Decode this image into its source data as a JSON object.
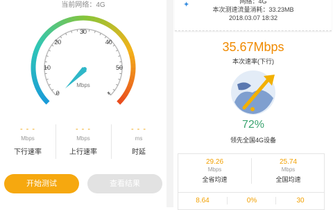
{
  "left": {
    "network_label": "当前网络：4G",
    "gauge": {
      "ticks": [
        "0",
        "10",
        "20",
        "30",
        "40",
        "50",
        "+"
      ],
      "unit": "Mbps",
      "needle_value": 0
    },
    "metrics": [
      {
        "value": "- - -",
        "unit": "Mbps",
        "label": "下行速率"
      },
      {
        "value": "- - -",
        "unit": "Mbps",
        "label": "上行速率"
      },
      {
        "value": "- - -",
        "unit": "ms",
        "label": "时延"
      }
    ],
    "buttons": {
      "start": "开始测试",
      "result": "查看结果"
    }
  },
  "right": {
    "card": {
      "network": "网络：4G",
      "traffic": "本次测速流量消耗：33.23MB",
      "datetime": "2018.03.07  18:32"
    },
    "speed_value": "35.67Mbps",
    "speed_label": "本次速率(下行)",
    "percent_value": "72%",
    "percent_label": "领先全国4G设备",
    "stats": [
      {
        "value": "29.26",
        "unit": "Mbps",
        "label": "全省均速"
      },
      {
        "value": "25.74",
        "unit": "Mbps",
        "label": "全国均速"
      },
      {
        "value": "8.64",
        "unit": "",
        "label": ""
      },
      {
        "value": "0%",
        "unit": "",
        "label": ""
      },
      {
        "value": "30",
        "unit": "",
        "label": ""
      }
    ]
  },
  "colors": {
    "accent": "#f6a80f",
    "speed": "#f08a00",
    "percent": "#3aa36f",
    "gauge_start": "#1a9bd8",
    "gauge_mid": "#7cc33d",
    "gauge_end": "#e8461e"
  }
}
